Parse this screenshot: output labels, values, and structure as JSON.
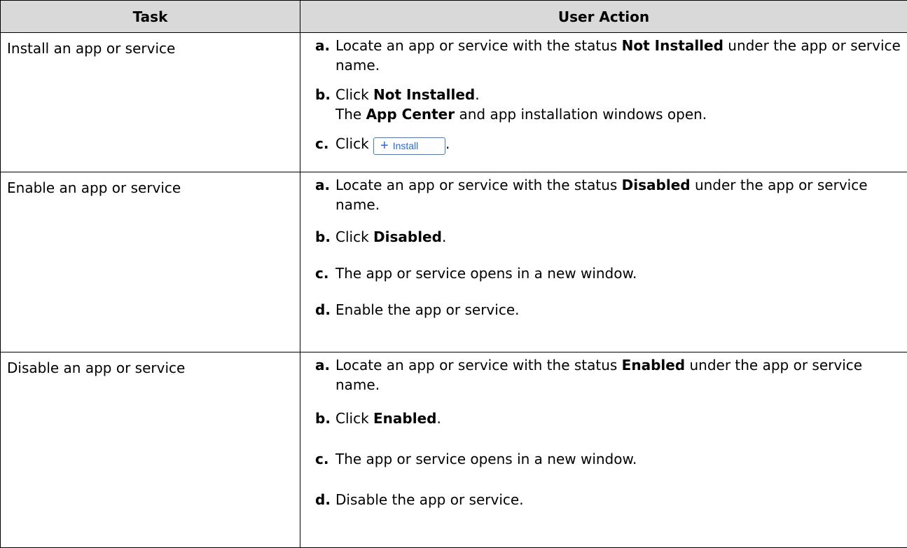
{
  "headers": {
    "task": "Task",
    "action": "User Action"
  },
  "rows": [
    {
      "task": "Install an app or service",
      "steps": [
        {
          "label": "a.",
          "pre": "Locate an app or service with the status ",
          "bold": "Not Installed",
          "post": " under the app or service name."
        },
        {
          "label": "b.",
          "pre": "Click ",
          "bold": "Not Installed",
          "post": ".",
          "line2_pre": "The ",
          "line2_bold": "App Center",
          "line2_post": " and app installation windows open."
        },
        {
          "label": "c.",
          "pre": "Click ",
          "button": "Install",
          "post": "."
        }
      ]
    },
    {
      "task": "Enable an app or service",
      "steps": [
        {
          "label": "a.",
          "pre": "Locate an app or service with the status ",
          "bold": "Disabled",
          "post": " under the app or service name."
        },
        {
          "label": "b.",
          "pre": "Click ",
          "bold": "Disabled",
          "post": "."
        },
        {
          "label": "c.",
          "text": "The app or service opens in a new window."
        },
        {
          "label": "d.",
          "text": "Enable the app or service."
        }
      ]
    },
    {
      "task": "Disable an app or service",
      "steps": [
        {
          "label": "a.",
          "pre": "Locate an app or service with the status ",
          "bold": "Enabled",
          "post": " under the app or service name."
        },
        {
          "label": "b.",
          "pre": "Click ",
          "bold": "Enabled",
          "post": "."
        },
        {
          "label": "c.",
          "text": "The app or service opens in a new window."
        },
        {
          "label": "d.",
          "text": "Disable the app or service."
        }
      ]
    }
  ]
}
